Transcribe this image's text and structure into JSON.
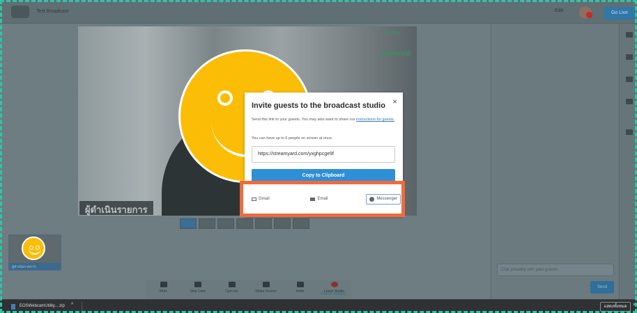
{
  "header": {
    "title": "Test Broadcast",
    "edit_label": "Edit",
    "go_live_label": "Go Live"
  },
  "stage": {
    "caption": "ผู้ดำเนินรายการ",
    "brand_mark": "Orrezo",
    "brand_name": "Greensid"
  },
  "thumbnail": {
    "label": "ผู้ดำเนินรายการ"
  },
  "controls": {
    "items": [
      "Mute",
      "Stop Cam",
      "Cam Ins",
      "Share Screen",
      "Invite",
      "Leave Studio"
    ],
    "link": "Check issues"
  },
  "chat": {
    "placeholder": "Chat privately with your guests",
    "send_label": "Send"
  },
  "modal": {
    "title": "Invite guests to the broadcast studio",
    "desc_prefix": "Send this link to your guests. You may also want to share our",
    "desc_link": "instructions for guests.",
    "limit": "You can have up to 6 people on screen at once.",
    "url": "https://streamyard.com/yxghpcge9f",
    "copy_label": "Copy to Clipboard",
    "share": {
      "gmail": "Gmail",
      "email": "Email",
      "messenger": "Messenger"
    }
  },
  "download_bar": {
    "filename": "EOSWebcamUtility....zip",
    "caret": "^",
    "show_all": "แสดงทั้งหมด",
    "close": "×"
  },
  "colors": {
    "accent": "#2e8fd6",
    "highlight": "#f26a3c",
    "smiley": "#fbbd05",
    "frame": "#34c2a4"
  }
}
